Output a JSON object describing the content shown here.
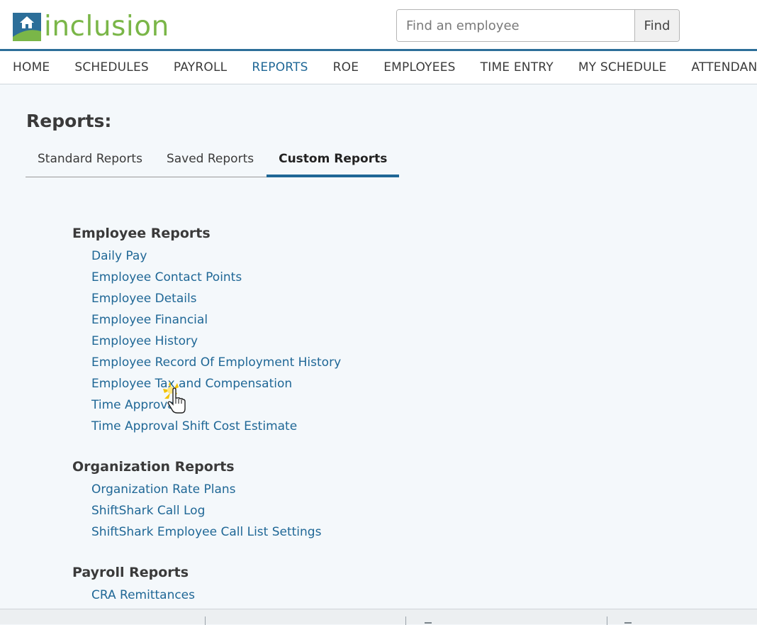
{
  "header": {
    "logo_text": "inclusion",
    "search_placeholder": "Find an employee",
    "find_label": "Find"
  },
  "nav": {
    "items": [
      "HOME",
      "SCHEDULES",
      "PAYROLL",
      "REPORTS",
      "ROE",
      "EMPLOYEES",
      "TIME ENTRY",
      "MY SCHEDULE",
      "ATTENDANCE"
    ],
    "active": "REPORTS"
  },
  "page": {
    "title": "Reports:",
    "tabs": [
      "Standard Reports",
      "Saved Reports",
      "Custom Reports"
    ],
    "active_tab": "Custom Reports"
  },
  "sections": [
    {
      "title": "Employee Reports",
      "links": [
        "Daily Pay",
        "Employee Contact Points",
        "Employee Details",
        "Employee Financial",
        "Employee History",
        "Employee Record Of Employment History",
        "Employee Tax and Compensation",
        "Time Approval",
        "Time Approval Shift Cost Estimate"
      ]
    },
    {
      "title": "Organization Reports",
      "links": [
        "Organization Rate Plans",
        "ShiftShark Call Log",
        "ShiftShark Employee Call List Settings"
      ]
    },
    {
      "title": "Payroll Reports",
      "links": [
        "CRA Remittances"
      ]
    }
  ],
  "colors": {
    "brand_green": "#7ab648",
    "brand_blue": "#2c6e99",
    "link": "#1f6796"
  }
}
